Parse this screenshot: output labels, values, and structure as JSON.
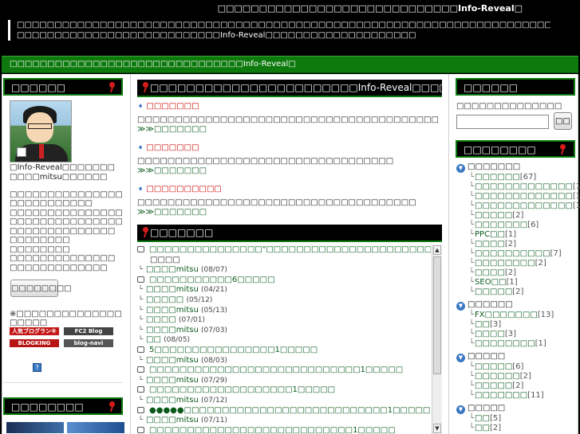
{
  "header": {
    "site_title": "□□□□□□□□□□□□□□□□□□□□□□□□□□□□□Info-Reveal□",
    "description_line1": "□□□□□□□□□□□□□□□□□□□□□□□□□□□□□□□□□□□□□□□□□□□□□□□□□□□□□□□□□□□□□□□□□□□□□□□□□□",
    "description_line2": "□□□□□□□□□□□□□□□□□□□□□□□□□□□Info-Reveal□□□□□□□□□□□□□□□□□□□□"
  },
  "green_bar": {
    "text": "□□□□□□□□□□□□□□□□□□□□□□□□□□□□□□□Info-Reveal□"
  },
  "left": {
    "profile_heading": "□□□□□□",
    "profile_line1": "□Info-Reveal□□□□□□□",
    "profile_line2": "□□□□mitsu□□□□□□",
    "profile_body": [
      "□□□□□□□□□□□□□□□",
      "□□□□□□□□□□□",
      "□□□□□□□□□□□□□□□",
      "□□□□□□□□□□□□□□□",
      "□□□□□□□□□□□□□□",
      "□□□□□□□□",
      "□□□□□□□□",
      "□□□□□□□□□□□□□□",
      "□□□□□□□□□□□□□"
    ],
    "profile_button": "□□□□□□□□",
    "ranking_note1": "※□□□□□□□□□□□□□□",
    "ranking_note2": "□□□□□",
    "banners": [
      "人気ブログランキング",
      "FC2 Blog Ranking",
      "BLOGKING",
      "blog-navi"
    ],
    "qr_icon": "?",
    "bottom_heading": "□□□□□□□□"
  },
  "center": {
    "top_heading": "□□□□□□□□□□□□□□□□□□□□□□□Info-Reveal□□□□□□□□",
    "sections": [
      {
        "title": "□□□□□□□",
        "text": "□□□□□□□□□□□□□□□□□□□□□□□□□□□□□□□□□□□□□□□□",
        "more": "≫≫□□□□□□□"
      },
      {
        "title": "□□□□□□□",
        "text": "□□□□□□□□□□□□□□□□□□□□□□□□□□□□□□□□□□",
        "more": "≫≫□□□□□□□"
      },
      {
        "title": "□□□□□□□□□□",
        "text": "□□□□□□□□□□□□□□□□□□□□□□□□□□□□□□□□□□□□□",
        "more": "≫≫□□□□□□□"
      }
    ],
    "comments_heading": "□□□□□□□",
    "comments": [
      {
        "kind": "post",
        "text": "□□□□□□□□□□□□□□□\"□□□□□□□□□□□□□□□□□□□□□□□□□□□□□\"□□□□□□□□□□1",
        "extra": ""
      },
      {
        "kind": "wrap",
        "text": "□□□□",
        "extra": ""
      },
      {
        "kind": "reply",
        "text": "□□□□mitsu",
        "extra": "(08/07)"
      },
      {
        "kind": "post",
        "text": "□□□□□□□□□□□6□□□□□",
        "extra": ""
      },
      {
        "kind": "reply",
        "text": "□□□□mitsu",
        "extra": "(04/21)"
      },
      {
        "kind": "reply",
        "text": "□□□□□",
        "extra": "(05/12)"
      },
      {
        "kind": "reply",
        "text": "□□□□mitsu",
        "extra": "(05/13)"
      },
      {
        "kind": "reply",
        "text": "□□□□",
        "extra": "(07/01)"
      },
      {
        "kind": "reply",
        "text": "□□□□mitsu",
        "extra": "(07/03)"
      },
      {
        "kind": "reply",
        "text": "□□",
        "extra": "(08/05)"
      },
      {
        "kind": "post",
        "text": "5□□□□□□□□□□□□□□□□1□□□□□",
        "extra": ""
      },
      {
        "kind": "reply",
        "text": "□□□□mitsu",
        "extra": "(08/03)"
      },
      {
        "kind": "post",
        "text": "□□□□□□□□□□□□□□□□□□□□□□□□□□□□1□□□□□",
        "extra": ""
      },
      {
        "kind": "reply",
        "text": "□□□□mitsu",
        "extra": "(07/29)"
      },
      {
        "kind": "post",
        "text": "□□□□□□□□□□□□□□□□□□□1□□□□□",
        "extra": ""
      },
      {
        "kind": "reply",
        "text": "□□□□mitsu",
        "extra": "(07/12)"
      },
      {
        "kind": "post",
        "text": "●●●●●□□□□□□□□□□□□□□□□□□□□□□□□□□□1□□□□□",
        "extra": ""
      },
      {
        "kind": "reply",
        "text": "□□□□mitsu",
        "extra": "(07/11)"
      },
      {
        "kind": "post",
        "text": "□□□□□□□□□□□□□□□□□□□□□□□□□□□1□□□□□",
        "extra": ""
      }
    ]
  },
  "right": {
    "search_heading": "□□□□□□",
    "search_hint": "□□□□□□□□□□□□□□",
    "search_value": "",
    "search_button": "□□",
    "category_heading": "□□□□□□□□",
    "groups": [
      {
        "name": "□□□□□□□",
        "items": [
          {
            "label": "□□□□□□",
            "count": "[67]"
          },
          {
            "label": "□□□□□□□□□□□□□",
            "count": "[13]"
          },
          {
            "label": "□□□□□□□□□□□□□",
            "count": "[10]"
          },
          {
            "label": "□□□□□□□□□□□□□",
            "count": "[10]"
          },
          {
            "label": "□□□□□",
            "count": "[2]"
          },
          {
            "label": "□□□□□□□",
            "count": "[6]"
          },
          {
            "label": "PPC□□",
            "count": "[1]"
          },
          {
            "label": "□□□□",
            "count": "[2]"
          },
          {
            "label": "□□□□□□□□□□",
            "count": "[7]"
          },
          {
            "label": "□□□□□□□□",
            "count": "[2]"
          },
          {
            "label": "□□□□",
            "count": "[2]"
          },
          {
            "label": "SEO□□",
            "count": "[1]"
          },
          {
            "label": "□□□□□",
            "count": "[2]"
          }
        ]
      },
      {
        "name": "□□□□□□",
        "items": [
          {
            "label": "FX□□□□□□□",
            "count": "[13]"
          },
          {
            "label": "□□",
            "count": "[3]"
          },
          {
            "label": "□□□□",
            "count": "[3]"
          },
          {
            "label": "□□□□□□□□",
            "count": "[1]"
          }
        ]
      },
      {
        "name": "□□□□□",
        "items": [
          {
            "label": "□□□□□",
            "count": "[6]"
          },
          {
            "label": "□□□□□□",
            "count": "[2]"
          },
          {
            "label": "□□□□□",
            "count": "[2]"
          },
          {
            "label": "□□□□□□□",
            "count": "[11]"
          }
        ]
      },
      {
        "name": "□□□□□",
        "items": [
          {
            "label": "□□",
            "count": "[5]"
          },
          {
            "label": "□□",
            "count": "[2]"
          }
        ]
      }
    ]
  },
  "colors": {
    "green": "#0e7a0e",
    "pin": "#d61c1c",
    "link": "#0a5a1a",
    "section_title": "#cc0000"
  }
}
